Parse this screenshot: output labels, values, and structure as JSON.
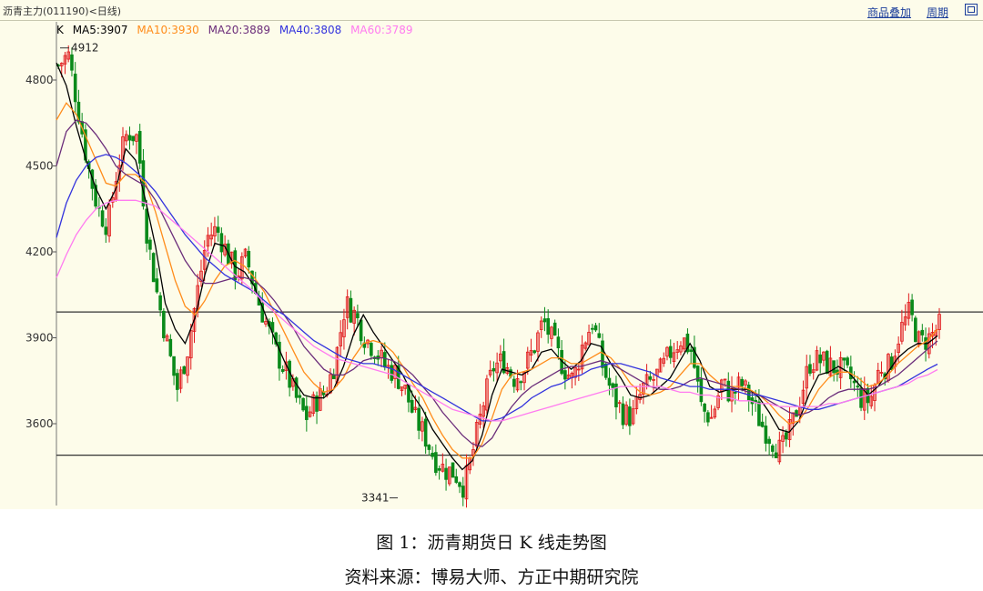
{
  "header": {
    "title": "沥青主力(011190)<日线)",
    "overlay_label": "商品叠加",
    "period_label": "周期",
    "restore_icon": "window-restore-icon"
  },
  "legend": {
    "k_label": "K",
    "ma5": "MA5:3907",
    "ma10": "MA10:3930",
    "ma20": "MA20:3889",
    "ma40": "MA40:3808",
    "ma60": "MA60:3789",
    "colors": {
      "k": "#000000",
      "ma5": "#000000",
      "ma10": "#ff8c1a",
      "ma20": "#6b2d7a",
      "ma40": "#3333dd",
      "ma60": "#ff7bf0"
    }
  },
  "caption": {
    "title": "图 1：沥青期货日 K 线走势图",
    "source": "资料来源：博易大师、方正中期研究院"
  },
  "chart_data": {
    "type": "candlestick",
    "title": "沥青主力(011190)<日线)",
    "ylim": [
      3380,
      4930
    ],
    "yticks": [
      3600,
      3900,
      4200,
      4500,
      4800
    ],
    "high_label": "4912",
    "low_label": "3341",
    "high_value": 4912,
    "low_value": 3341,
    "support_line": 3490,
    "resistance_line": 3990,
    "grid": false,
    "up_color": "#e0191b",
    "down_color": "#0a8a1a",
    "ma_series": [
      {
        "name": "MA5",
        "color": "#000000",
        "values": [
          4860,
          4780,
          4640,
          4520,
          4420,
          4350,
          4420,
          4560,
          4520,
          4380,
          4220,
          4020,
          3930,
          3880,
          3970,
          4120,
          4230,
          4220,
          4150,
          4130,
          4080,
          3990,
          3900,
          3820,
          3750,
          3700,
          3690,
          3690,
          3720,
          3800,
          3910,
          3980,
          3920,
          3870,
          3820,
          3770,
          3700,
          3650,
          3580,
          3530,
          3480,
          3440,
          3470,
          3560,
          3700,
          3790,
          3780,
          3770,
          3790,
          3850,
          3860,
          3820,
          3790,
          3820,
          3880,
          3870,
          3810,
          3760,
          3700,
          3690,
          3700,
          3730,
          3760,
          3820,
          3880,
          3820,
          3730,
          3710,
          3720,
          3720,
          3720,
          3690,
          3640,
          3580,
          3570,
          3610,
          3700,
          3770,
          3780,
          3800,
          3780,
          3740,
          3700,
          3730,
          3780,
          3830,
          3860,
          3880,
          3880,
          3907
        ]
      },
      {
        "name": "MA10",
        "color": "#ff8c1a",
        "values": [
          4660,
          4720,
          4680,
          4600,
          4520,
          4440,
          4430,
          4470,
          4470,
          4440,
          4340,
          4220,
          4100,
          4010,
          3980,
          4030,
          4100,
          4150,
          4170,
          4150,
          4110,
          4060,
          3990,
          3920,
          3850,
          3780,
          3740,
          3710,
          3720,
          3760,
          3830,
          3880,
          3890,
          3880,
          3850,
          3800,
          3740,
          3690,
          3620,
          3560,
          3510,
          3480,
          3480,
          3530,
          3620,
          3720,
          3770,
          3780,
          3790,
          3810,
          3830,
          3830,
          3810,
          3810,
          3830,
          3850,
          3830,
          3790,
          3740,
          3710,
          3700,
          3710,
          3730,
          3770,
          3810,
          3810,
          3770,
          3740,
          3730,
          3730,
          3720,
          3700,
          3670,
          3630,
          3600,
          3610,
          3660,
          3720,
          3760,
          3780,
          3780,
          3760,
          3730,
          3740,
          3770,
          3810,
          3840,
          3870,
          3890,
          3930
        ]
      },
      {
        "name": "MA20",
        "color": "#6b2d7a",
        "values": [
          4500,
          4620,
          4660,
          4650,
          4610,
          4560,
          4500,
          4470,
          4450,
          4430,
          4380,
          4310,
          4240,
          4170,
          4120,
          4090,
          4090,
          4100,
          4110,
          4110,
          4100,
          4070,
          4030,
          3980,
          3930,
          3870,
          3830,
          3790,
          3770,
          3770,
          3790,
          3820,
          3830,
          3830,
          3820,
          3800,
          3770,
          3730,
          3690,
          3640,
          3600,
          3560,
          3530,
          3520,
          3550,
          3610,
          3660,
          3700,
          3730,
          3750,
          3770,
          3790,
          3800,
          3800,
          3810,
          3820,
          3810,
          3790,
          3770,
          3750,
          3730,
          3720,
          3720,
          3730,
          3750,
          3760,
          3750,
          3740,
          3730,
          3720,
          3710,
          3700,
          3680,
          3660,
          3640,
          3630,
          3640,
          3660,
          3690,
          3710,
          3720,
          3720,
          3720,
          3730,
          3750,
          3770,
          3800,
          3830,
          3860,
          3889
        ]
      },
      {
        "name": "MA40",
        "color": "#3333dd",
        "values": [
          4250,
          4370,
          4450,
          4500,
          4530,
          4540,
          4530,
          4510,
          4480,
          4450,
          4410,
          4360,
          4310,
          4260,
          4220,
          4180,
          4150,
          4120,
          4100,
          4080,
          4060,
          4030,
          4000,
          3980,
          3950,
          3920,
          3890,
          3870,
          3850,
          3830,
          3820,
          3810,
          3810,
          3800,
          3790,
          3770,
          3750,
          3730,
          3710,
          3690,
          3670,
          3650,
          3630,
          3610,
          3610,
          3620,
          3640,
          3660,
          3690,
          3710,
          3730,
          3740,
          3760,
          3770,
          3790,
          3800,
          3810,
          3810,
          3800,
          3790,
          3780,
          3760,
          3750,
          3740,
          3730,
          3730,
          3720,
          3720,
          3720,
          3710,
          3700,
          3700,
          3690,
          3680,
          3670,
          3660,
          3650,
          3650,
          3660,
          3670,
          3680,
          3690,
          3700,
          3710,
          3720,
          3730,
          3750,
          3770,
          3790,
          3808
        ]
      },
      {
        "name": "MA60",
        "color": "#ff7bf0",
        "values": [
          4110,
          4190,
          4260,
          4310,
          4350,
          4370,
          4380,
          4380,
          4380,
          4370,
          4360,
          4330,
          4300,
          4270,
          4240,
          4210,
          4180,
          4150,
          4120,
          4090,
          4060,
          4020,
          3990,
          3960,
          3930,
          3900,
          3870,
          3850,
          3830,
          3820,
          3810,
          3800,
          3790,
          3780,
          3770,
          3750,
          3730,
          3710,
          3690,
          3670,
          3650,
          3640,
          3630,
          3620,
          3610,
          3610,
          3620,
          3630,
          3640,
          3650,
          3660,
          3670,
          3680,
          3690,
          3700,
          3710,
          3720,
          3730,
          3730,
          3730,
          3730,
          3730,
          3720,
          3710,
          3710,
          3700,
          3700,
          3690,
          3690,
          3680,
          3680,
          3670,
          3670,
          3660,
          3660,
          3660,
          3660,
          3660,
          3670,
          3670,
          3680,
          3690,
          3700,
          3710,
          3720,
          3730,
          3740,
          3760,
          3770,
          3789
        ]
      }
    ],
    "close_path": [
      4850,
      4890,
      4700,
      4500,
      4350,
      4290,
      4500,
      4620,
      4600,
      4250,
      4050,
      3880,
      3720,
      3850,
      4050,
      4250,
      4280,
      4200,
      4120,
      4180,
      4050,
      3950,
      3850,
      3780,
      3690,
      3620,
      3680,
      3710,
      3820,
      4020,
      3980,
      3900,
      3860,
      3800,
      3780,
      3720,
      3620,
      3560,
      3480,
      3440,
      3430,
      3380,
      3520,
      3680,
      3800,
      3820,
      3760,
      3790,
      3860,
      3960,
      3880,
      3800,
      3750,
      3880,
      3960,
      3800,
      3700,
      3640,
      3620,
      3720,
      3750,
      3790,
      3860,
      3900,
      3850,
      3650,
      3620,
      3740,
      3700,
      3740,
      3680,
      3600,
      3550,
      3500,
      3580,
      3700,
      3820,
      3820,
      3800,
      3790,
      3760,
      3690,
      3680,
      3800,
      3800,
      3920,
      3990,
      3880,
      3900,
      3940
    ]
  }
}
